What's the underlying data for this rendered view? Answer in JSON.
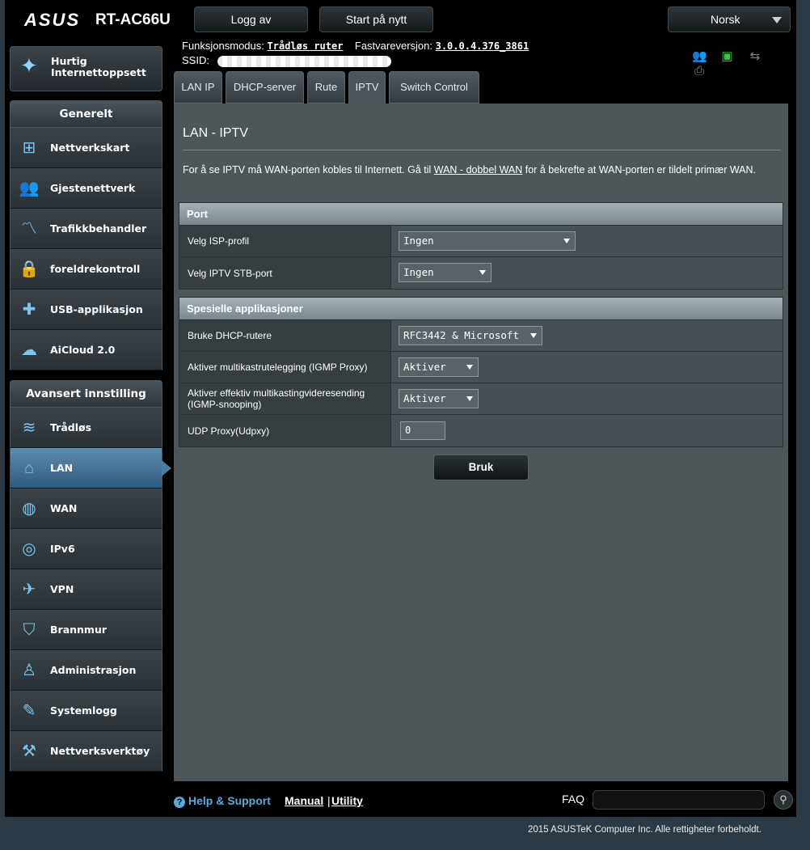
{
  "header": {
    "brand": "ASUS",
    "model": "RT-AC66U",
    "logout_label": "Logg av",
    "restart_label": "Start på nytt",
    "language": "Norsk"
  },
  "info": {
    "mode_label": "Funksjonsmodus:",
    "mode_value": "Trådløs ruter",
    "firmware_label": "Fastvareversjon:",
    "firmware_value": "3.0.0.4.376_3861",
    "ssid_label": "SSID:"
  },
  "sidebar": {
    "quick_setup": "Hurtig Internettoppsett",
    "general_header": "Generelt",
    "general_items": [
      {
        "label": "Nettverkskart",
        "icon": "network-map-icon"
      },
      {
        "label": "Gjestenettverk",
        "icon": "guest-network-icon"
      },
      {
        "label": "Trafikkbehandler",
        "icon": "traffic-manager-icon"
      },
      {
        "label": "foreldrekontroll",
        "icon": "lock-icon"
      },
      {
        "label": "USB-applikasjon",
        "icon": "puzzle-icon"
      },
      {
        "label": "AiCloud 2.0",
        "icon": "cloud-icon"
      }
    ],
    "advanced_header": "Avansert innstilling",
    "advanced_items": [
      {
        "label": "Trådløs",
        "icon": "wifi-icon"
      },
      {
        "label": "LAN",
        "icon": "home-icon"
      },
      {
        "label": "WAN",
        "icon": "globe-icon"
      },
      {
        "label": "IPv6",
        "icon": "ipv6-icon"
      },
      {
        "label": "VPN",
        "icon": "vpn-icon"
      },
      {
        "label": "Brannmur",
        "icon": "shield-icon"
      },
      {
        "label": "Administrasjon",
        "icon": "user-icon"
      },
      {
        "label": "Systemlogg",
        "icon": "log-icon"
      },
      {
        "label": "Nettverksverktøy",
        "icon": "tools-icon"
      }
    ]
  },
  "tabs": [
    "LAN IP",
    "DHCP-server",
    "Rute",
    "IPTV",
    "Switch Control"
  ],
  "main": {
    "title": "LAN - IPTV",
    "desc_part1": "For å se IPTV må WAN-porten kobles til Internett. Gå til ",
    "desc_link": "WAN - dobbel WAN",
    "desc_part2": " for å bekrefte at WAN-porten er tildelt primær WAN.",
    "port": {
      "header": "Port",
      "isp_label": "Velg ISP-profil",
      "isp_value": "Ingen",
      "stb_label": "Velg IPTV STB-port",
      "stb_value": "Ingen"
    },
    "special": {
      "header": "Spesielle applikasjoner",
      "dhcp_label": "Bruke DHCP-rutere",
      "dhcp_value": "RFC3442 & Microsoft",
      "igmp_label": "Aktiver multikastrutelegging (IGMP Proxy)",
      "igmp_value": "Aktiver",
      "snoop_label": "Aktiver effektiv multikastingvideresending (IGMP-snooping)",
      "snoop_value": "Aktiver",
      "udp_label": "UDP Proxy(Udpxy)",
      "udp_value": "0"
    },
    "apply_label": "Bruk"
  },
  "footer": {
    "help": "Help & Support",
    "manual": "Manual",
    "separator": "|",
    "utility": "Utility",
    "faq": "FAQ",
    "copyright": "2015 ASUSTeK Computer Inc. Alle rettigheter forbeholdt."
  },
  "colors": {
    "accent": "#5aa9dd",
    "active_menu": "#4c7ea4",
    "usb_status": "#3ec43e"
  }
}
